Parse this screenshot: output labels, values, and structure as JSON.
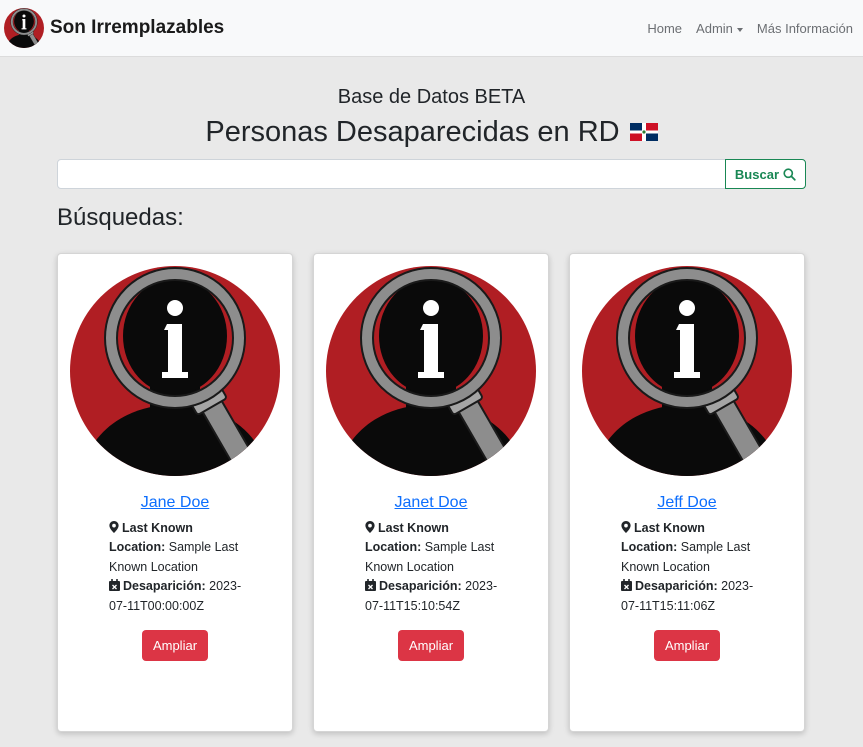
{
  "navbar": {
    "brand": "Son Irremplazables",
    "links": [
      {
        "label": "Home"
      },
      {
        "label": "Admin"
      },
      {
        "label": "Más Información"
      }
    ]
  },
  "header": {
    "subtitle": "Base de Datos BETA",
    "title": "Personas Desaparecidas en RD"
  },
  "search": {
    "value": "",
    "button_label": "Buscar"
  },
  "section_title": "Búsquedas:",
  "cards": [
    {
      "name": "Jane Doe",
      "location_label": "Last Known Location:",
      "location": "Sample Last Known Location",
      "date_label": "Desaparición:",
      "date": "2023-07-11T00:00:00Z",
      "button": "Ampliar"
    },
    {
      "name": "Janet Doe",
      "location_label": "Last Known Location:",
      "location": "Sample Last Known Location",
      "date_label": "Desaparición:",
      "date": "2023-07-11T15:10:54Z",
      "button": "Ampliar"
    },
    {
      "name": "Jeff Doe",
      "location_label": "Last Known Location:",
      "location": "Sample Last Known Location",
      "date_label": "Desaparición:",
      "date": "2023-07-11T15:11:06Z",
      "button": "Ampliar"
    }
  ],
  "icons": {
    "logo": "magnifier-info-silhouette-icon",
    "location": "map-marker-icon",
    "date": "calendar-x-icon",
    "search": "search-icon",
    "flag": "dominican-republic-flag-icon"
  },
  "colors": {
    "link": "#0d6efd",
    "danger": "#dc3545",
    "success": "#198754",
    "logo_red": "#b01e23"
  }
}
